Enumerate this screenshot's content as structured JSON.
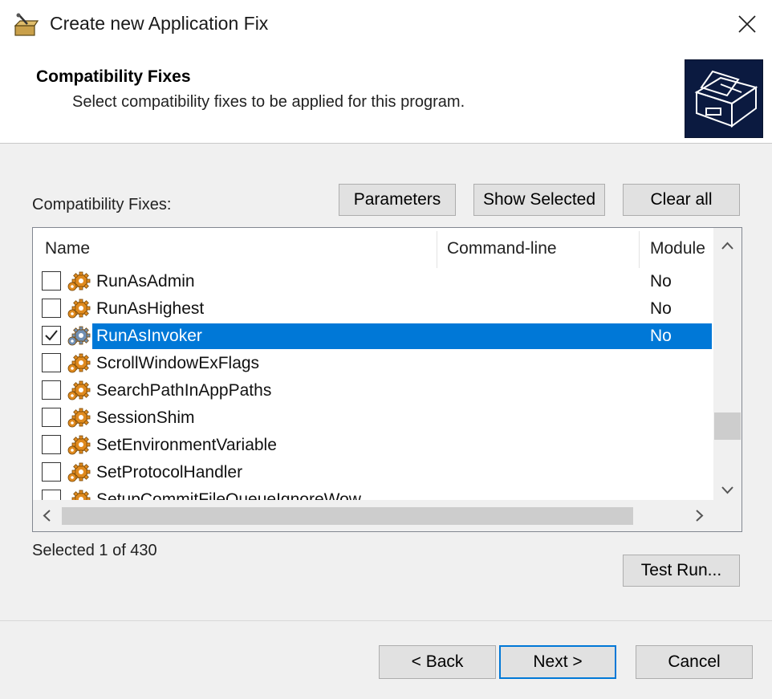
{
  "window": {
    "title": "Create new Application Fix",
    "title_icon": "app-fix-wizard-icon",
    "close_icon": "close-icon"
  },
  "header": {
    "title": "Compatibility Fixes",
    "subtitle": "Select compatibility fixes to be applied for this program.",
    "image": "wizard-banner-icon"
  },
  "fixes_section": {
    "label": "Compatibility Fixes:",
    "buttons": {
      "parameters": "Parameters",
      "show_selected": "Show Selected",
      "clear_all": "Clear all"
    }
  },
  "list": {
    "columns": [
      "Name",
      "Command-line",
      "Module"
    ],
    "rows": [
      {
        "name": "RunAsAdmin",
        "command_line": "",
        "module": "No",
        "checked": false,
        "selected": false
      },
      {
        "name": "RunAsHighest",
        "command_line": "",
        "module": "No",
        "checked": false,
        "selected": false
      },
      {
        "name": "RunAsInvoker",
        "command_line": "",
        "module": "No",
        "checked": true,
        "selected": true
      },
      {
        "name": "ScrollWindowExFlags",
        "command_line": "",
        "module": "",
        "checked": false,
        "selected": false
      },
      {
        "name": "SearchPathInAppPaths",
        "command_line": "",
        "module": "",
        "checked": false,
        "selected": false
      },
      {
        "name": "SessionShim",
        "command_line": "",
        "module": "",
        "checked": false,
        "selected": false
      },
      {
        "name": "SetEnvironmentVariable",
        "command_line": "",
        "module": "",
        "checked": false,
        "selected": false
      },
      {
        "name": "SetProtocolHandler",
        "command_line": "",
        "module": "",
        "checked": false,
        "selected": false
      },
      {
        "name": "SetupCommitFileQueueIgnoreWow",
        "command_line": "",
        "module": "",
        "checked": false,
        "selected": false
      }
    ]
  },
  "status": {
    "selected_text": "Selected 1 of 430"
  },
  "buttons": {
    "test_run": "Test Run...",
    "back": "< Back",
    "next": "Next >",
    "cancel": "Cancel"
  },
  "colors": {
    "selection": "#0078d7",
    "background": "#f0f0f0",
    "gear": "#e08a1e"
  }
}
